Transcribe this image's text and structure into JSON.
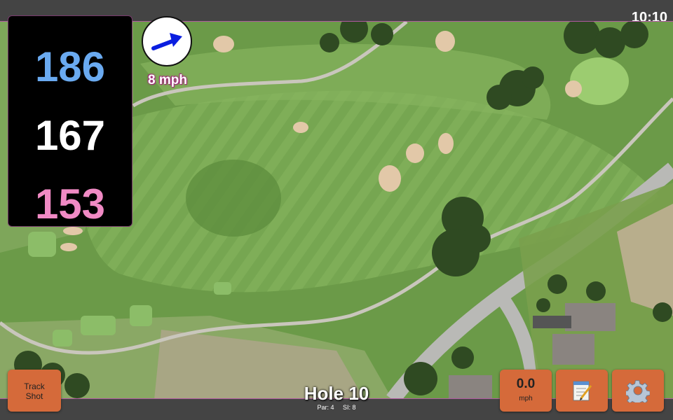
{
  "status_bar": {
    "time": "10:10"
  },
  "yardage": {
    "back": "186",
    "middle": "167",
    "front": "153"
  },
  "wind": {
    "icon": "wind-direction-arrow-icon",
    "speed": "8 mph"
  },
  "hole": {
    "title": "Hole 10",
    "par": "Par: 4",
    "si": "SI: 8"
  },
  "buttons": {
    "track_shot_line1": "Track",
    "track_shot_line2": "Shot",
    "speed_value": "0.0",
    "speed_unit": "mph",
    "notes_icon": "notepad-icon",
    "settings_icon": "gear-icon"
  },
  "colors": {
    "back_yardage": "#6aaaf0",
    "middle_yardage": "#ffffff",
    "front_yardage": "#f08ac4",
    "button_bg": "#d56a3a",
    "accent_border": "#b05aa0"
  }
}
